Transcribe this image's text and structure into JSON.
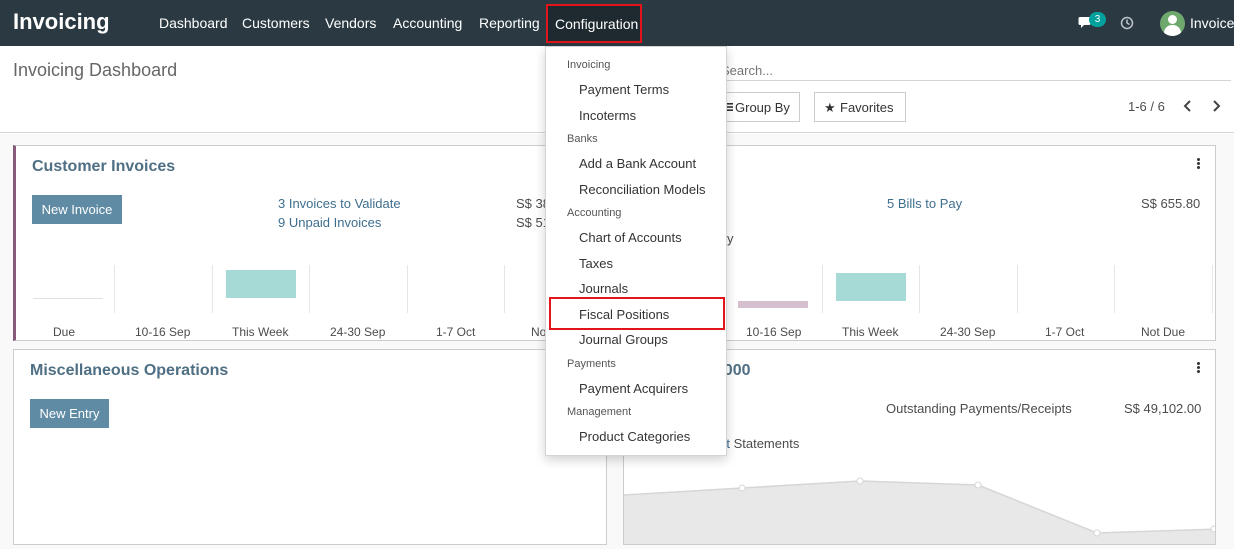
{
  "navbar": {
    "brand": "Invoicing",
    "menu": [
      "Dashboard",
      "Customers",
      "Vendors",
      "Accounting",
      "Reporting"
    ],
    "active_menu": "Configuration",
    "chat_badge": "3",
    "user": "Invoice"
  },
  "control_panel": {
    "title": "Invoicing Dashboard",
    "search_placeholder": "Search...",
    "group_by": "Group By",
    "favorites": "Favorites",
    "pager": "1-6 / 6"
  },
  "cards": {
    "customer_invoices": {
      "title": "Customer Invoices",
      "button": "New Invoice",
      "links": [
        "3 Invoices to Validate",
        "9 Unpaid Invoices"
      ],
      "amounts": [
        "S$ 38",
        "S$ 51"
      ],
      "chart_labels": [
        "Due",
        "10-16 Sep",
        "This Week",
        "24-30 Sep",
        "1-7 Oct",
        "No"
      ]
    },
    "vendor_bills": {
      "link": "5 Bills to Pay",
      "amount": "S$ 655.80",
      "partial_text": "y",
      "chart_labels": [
        "10-16 Sep",
        "This Week",
        "24-30 Sep",
        "1-7 Oct",
        "Not Due"
      ]
    },
    "misc_operations": {
      "title": "Miscellaneous Operations",
      "button": "New Entry"
    },
    "bank": {
      "title_partial": "00000",
      "label": "Outstanding Payments/Receipts",
      "amount": "S$ 49,102.00",
      "link_partial": "rt",
      "link_rest": " Statements"
    }
  },
  "chart_data": [
    {
      "type": "bar",
      "categories": [
        "Due",
        "10-16 Sep",
        "This Week",
        "24-30 Sep",
        "1-7 Oct",
        "No"
      ],
      "values": [
        0,
        0,
        1,
        0,
        0,
        0
      ],
      "title": "",
      "xlabel": "",
      "ylabel": ""
    },
    {
      "type": "bar",
      "categories": [
        "10-16 Sep",
        "This Week",
        "24-30 Sep",
        "1-7 Oct",
        "Not Due"
      ],
      "values": [
        0.25,
        1,
        0,
        0,
        0
      ],
      "title": "",
      "xlabel": "",
      "ylabel": ""
    },
    {
      "type": "line",
      "values": [
        0.25,
        0.35,
        0.5,
        0.45,
        -0.3,
        -0.25
      ]
    }
  ],
  "colors": {
    "navbar": "#2b3a42",
    "highlight": "#e4141b",
    "title": "#4f6f84",
    "link": "#3e6e8e",
    "bar_teal": "#a6dad7",
    "bar_mauve": "#d6bfce",
    "accent_border": "#875a7b"
  },
  "dropdown": {
    "sections": [
      {
        "header": "Invoicing",
        "items": [
          "Payment Terms",
          "Incoterms"
        ]
      },
      {
        "header": "Banks",
        "items": [
          "Add a Bank Account",
          "Reconciliation Models"
        ]
      },
      {
        "header": "Accounting",
        "items": [
          "Chart of Accounts",
          "Taxes",
          "Journals",
          "Fiscal Positions",
          "Journal Groups"
        ]
      },
      {
        "header": "Payments",
        "items": [
          "Payment Acquirers"
        ]
      },
      {
        "header": "Management",
        "items": [
          "Product Categories"
        ]
      }
    ],
    "highlighted_item": "Fiscal Positions"
  }
}
